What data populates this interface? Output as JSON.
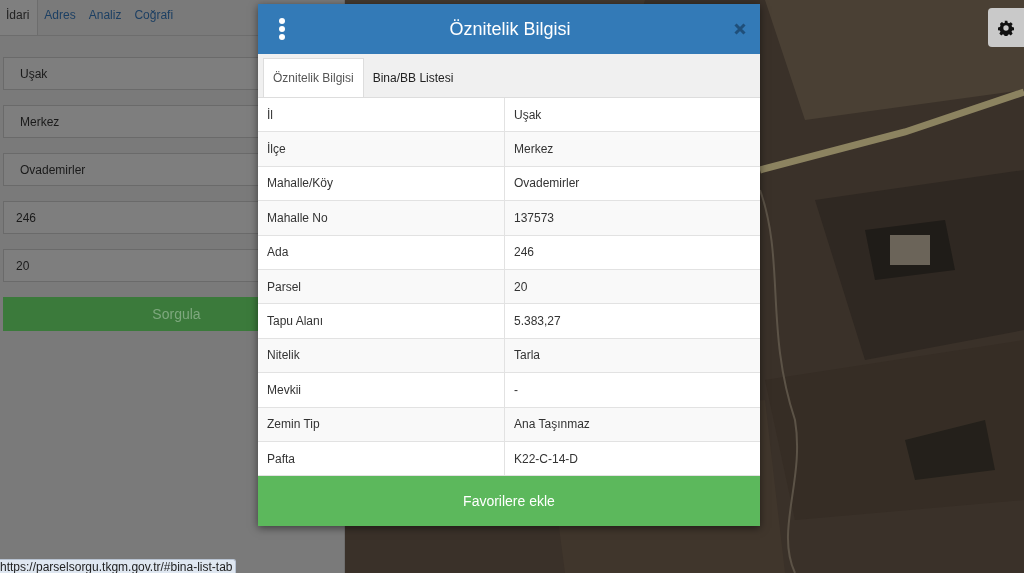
{
  "left_panel": {
    "tabs": [
      {
        "label": "İdari",
        "selected": true
      },
      {
        "label": "Adres",
        "selected": false
      },
      {
        "label": "Analiz",
        "selected": false
      },
      {
        "label": "Coğrafi",
        "selected": false
      }
    ],
    "fields": [
      {
        "value": "Uşak",
        "kind": "select"
      },
      {
        "value": "Merkez",
        "kind": "select"
      },
      {
        "value": "Ovademirler",
        "kind": "select"
      },
      {
        "value": "246",
        "kind": "input"
      },
      {
        "value": "20",
        "kind": "input"
      }
    ],
    "query_button": "Sorgula"
  },
  "modal": {
    "title": "Öznitelik Bilgisi",
    "tabs": [
      {
        "label": "Öznitelik Bilgisi",
        "selected": true
      },
      {
        "label": "Bina/BB Listesi",
        "selected": false
      }
    ],
    "rows": [
      {
        "label": "İl",
        "value": "Uşak"
      },
      {
        "label": "İlçe",
        "value": "Merkez"
      },
      {
        "label": "Mahalle/Köy",
        "value": "Ovademirler"
      },
      {
        "label": "Mahalle No",
        "value": "137573"
      },
      {
        "label": "Ada",
        "value": "246"
      },
      {
        "label": "Parsel",
        "value": "20"
      },
      {
        "label": "Tapu Alanı",
        "value": "5.383,27"
      },
      {
        "label": "Nitelik",
        "value": "Tarla"
      },
      {
        "label": "Mevkii",
        "value": "-"
      },
      {
        "label": "Zemin Tip",
        "value": "Ana Taşınmaz"
      },
      {
        "label": "Pafta",
        "value": "K22-C-14-D"
      }
    ],
    "favorite_button": "Favorilere ekle"
  },
  "status_url": "https://parselsorgu.tkgm.gov.tr/#bina-list-tab"
}
